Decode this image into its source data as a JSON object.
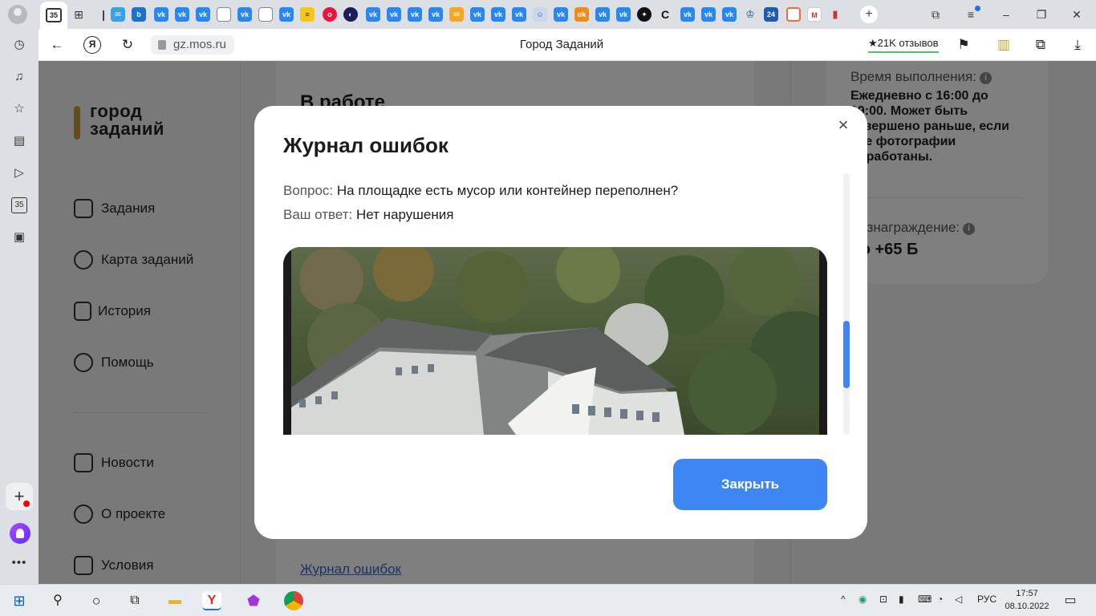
{
  "browser": {
    "tab_counter": "35",
    "url": "gz.mos.ru",
    "page_title": "Город Заданий",
    "reviews": "★21K отзывов"
  },
  "nav": {
    "logo": "город\nзаданий",
    "items": [
      {
        "label": "Задания"
      },
      {
        "label": "Карта заданий"
      },
      {
        "label": "История"
      },
      {
        "label": "Помощь"
      },
      {
        "label": "Новости"
      },
      {
        "label": "О проекте"
      },
      {
        "label": "Условия"
      }
    ]
  },
  "main": {
    "title": "В работе",
    "log_link": "Журнал ошибок"
  },
  "info": {
    "time_label": "Время выполнения:",
    "time_text": "Ежедневно с 16:00 до 19:00. Может быть завершено раньше, если все фотографии обработаны.",
    "reward_label": "Вознаграждение:",
    "reward_value": "до +65 Б"
  },
  "modal": {
    "title": "Журнал ошибок",
    "question_label": "Вопрос:",
    "question": "На площадке есть мусор или контейнер переполнен?",
    "answer_label": "Ваш ответ:",
    "answer": "Нет нарушения",
    "close_button": "Закрыть",
    "close_icon": "×"
  },
  "taskbar": {
    "lang": "РУС",
    "time": "17:57",
    "date": "08.10.2022"
  },
  "colors": {
    "accent": "#3d86f4",
    "logo_bar": "#c69b3a",
    "link": "#2f64c8"
  }
}
